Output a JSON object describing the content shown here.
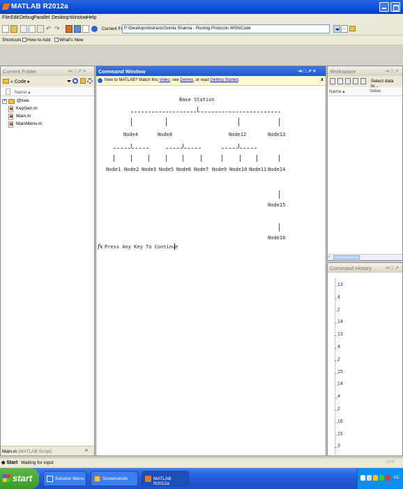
{
  "window": {
    "title": "MATLAB R2012a"
  },
  "menu": [
    "File",
    "Edit",
    "Debug",
    "Parallel",
    "Desktop",
    "Window",
    "Help"
  ],
  "toolbar": {
    "current_folder_label": "Current Folder:",
    "current_folder_path": "P:\\Desktop\\Abstracts\\Sunita Sharma - Routing Protocols WSN\\Code"
  },
  "shortcuts": {
    "label": "Shortcuts",
    "how_to_add": "How to Add",
    "whats_new": "What's New"
  },
  "current_folder": {
    "title": "Current Folder",
    "controls": "⇥ □ ↗ ×",
    "nav_path": "« Code ▸",
    "column_name": "Name ▴",
    "files": [
      {
        "name": "@tree",
        "type": "folder"
      },
      {
        "name": "KeyGen.m",
        "type": "file"
      },
      {
        "name": "Main.m",
        "type": "file"
      },
      {
        "name": "MainMenu.m",
        "type": "file"
      }
    ],
    "status_file": "Main.m",
    "status_type": "(MATLAB Script)"
  },
  "command_window": {
    "title": "Command Window",
    "controls": "⇥ □ ↗ ×",
    "notice": {
      "prefix": "New to MATLAB? Watch this ",
      "video": "Video",
      "mid1": ", see ",
      "demos": "Demos",
      "mid2": ", or read ",
      "getting_started": "Getting Started",
      "suffix": "."
    },
    "base_station": "Base Station",
    "level1": [
      "Node4",
      "Node8",
      "Node12",
      "Node13"
    ],
    "level2": [
      "Node1",
      "Node2",
      "Node3",
      "Node5",
      "Node6",
      "Node7",
      "Node9",
      "Node10",
      "Node11",
      "Node14"
    ],
    "level3": [
      "Node15"
    ],
    "level4": [
      "Node16"
    ],
    "prompt_symbol": "fx",
    "prompt_text": "Press Any Key To Continue"
  },
  "workspace": {
    "title": "Workspace",
    "controls": "⇥ □ ↗",
    "select_data": "Select data to...",
    "col_name": "Name ▴",
    "col_value": "Value"
  },
  "command_history": {
    "title": "Command History",
    "controls": "⇥ □ ↗",
    "entries": [
      "13",
      "4",
      "2",
      "14",
      "13",
      "4",
      "2",
      "15",
      "14",
      "4",
      "2",
      "16",
      "15",
      "3"
    ]
  },
  "statusbar": {
    "start": "Start",
    "status": "Waiting for input",
    "ovr": "OVR"
  },
  "taskbar": {
    "start": "start",
    "tasks": [
      "Solution Menu",
      "Screenshots",
      "MATLAB R2012a"
    ],
    "clock": "01:"
  }
}
